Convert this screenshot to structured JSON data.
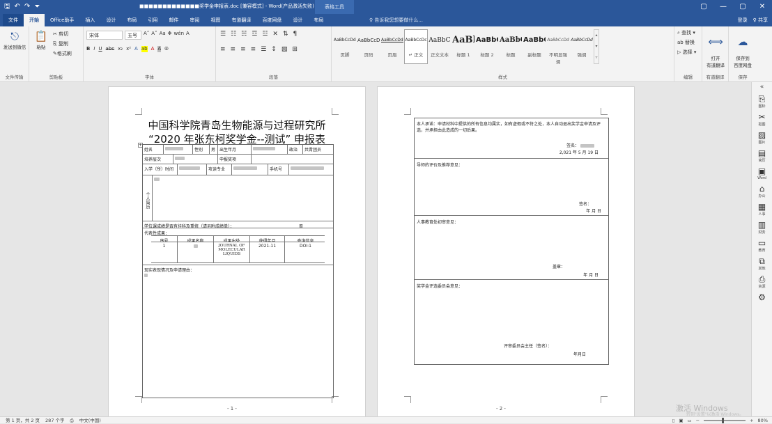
{
  "titlebar": {
    "doc_title": "■■■■■■■■■■■■■奖学金申报表.doc [兼容模式] - Word(产品激活失败)",
    "table_tools": "表格工具",
    "quick_access": [
      "🖫",
      "↶",
      "↷",
      "⏷"
    ],
    "controls": [
      "▢",
      "—",
      "▢",
      "✕"
    ]
  },
  "tabs": [
    "文件",
    "开始",
    "Office助手",
    "插入",
    "设计",
    "布局",
    "引用",
    "邮件",
    "审阅",
    "视图",
    "有道翻译",
    "百度网盘",
    "设计",
    "布局"
  ],
  "tell_me": "♀ 告诉我您想要做什么...",
  "account": {
    "login": "登录",
    "share": "♀ 共享"
  },
  "ribbon": {
    "groups": {
      "file_transfer": "文件传输",
      "clipboard": "剪贴板",
      "font": "字体",
      "paragraph": "段落",
      "styles": "样式",
      "editing": "编辑",
      "youdao": "有道翻译",
      "save": "保存"
    },
    "send_wechat": "发送到微信",
    "paste": "粘贴",
    "cut": "✂ 剪切",
    "copy": "⎘ 复制",
    "format_painter": "✎格式刷",
    "font_name": "宋体",
    "font_size": "五号",
    "font_row1": [
      "A˄",
      "A˅",
      "Aa",
      "✥",
      "wén",
      "A"
    ],
    "font_row2": [
      "B",
      "I",
      "U",
      "abc",
      "x₂",
      "x²",
      "A",
      "ab",
      "A",
      "A",
      "⦾"
    ],
    "para_row1": [
      "☰",
      "☷",
      "☵",
      "☲",
      "☳",
      "✕",
      "⇅",
      "¶"
    ],
    "para_row2": [
      "≡",
      "≡",
      "≡",
      "≡",
      "☰",
      "↕",
      "▧",
      "⊞"
    ],
    "styles": [
      {
        "sample": "AaBbCcDdE",
        "name": "页脚"
      },
      {
        "sample": "AaBbCcDd",
        "name": "页码"
      },
      {
        "sample": "AaBbCcDdE",
        "name": "页眉"
      },
      {
        "sample": "AaBbCcDc",
        "name": "↵ 正文"
      },
      {
        "sample": "AaBbC",
        "name": "正文文本"
      },
      {
        "sample": "AaBl",
        "name": "标题 1"
      },
      {
        "sample": "AaBbC",
        "name": "标题 2"
      },
      {
        "sample": "AaBbC",
        "name": "标题"
      },
      {
        "sample": "AaBbC",
        "name": "副标题"
      },
      {
        "sample": "AaBbCcDd",
        "name": "不明显强调"
      },
      {
        "sample": "AaBbCcDd",
        "name": "强调"
      }
    ],
    "find": "⌕ 查找 ▾",
    "replace": "ab 替换",
    "select": "▷ 选择 ▾",
    "open_youdao": "打开\n有道翻译",
    "save_baidu": "保存到\n百度网盘"
  },
  "page1": {
    "title1": "中国科学院青岛生物能源与过程研究所",
    "title2": "“2020 年张东柯奖学金--测试” 申报表",
    "row1": {
      "name_label": "姓名",
      "gender_label": "性别",
      "gender_value": "男",
      "birth_label": "出生年月",
      "politics_label": "政治面目",
      "politics_value": "共青团员"
    },
    "row2": {
      "edu_label": "培养层次",
      "award_label": "申报奖项"
    },
    "row3": {
      "entry_label": "入学（所）时间",
      "major_label": "攻读专业",
      "phone_label": "手机号"
    },
    "resume_label": "个人简历",
    "score_row": "学位课成绩是否有挂科及重修（请另附成绩单）：",
    "score_value": "否",
    "works_label": "代表性成果：",
    "works_headers": [
      "序号",
      "成果名称",
      "成果出处",
      "获得年月",
      "查询信息"
    ],
    "works_row": [
      "1",
      "",
      "JOURNAL OF MOLECULAR LIQUIDS",
      "2021-11",
      "DOI:1"
    ],
    "reason_label": "现实表现情况及申请理由：",
    "page_num": "- 1 -"
  },
  "page2": {
    "pledge": "本人承诺：申请材料中提供的所有信息均属实，如有虚假或不符之处，本人自动退出奖学金申请及评选，并承担由此造成的一切后果。",
    "sign_label": "签名：",
    "sign_date": "2,021 年 5 月 19 日",
    "advisor_label": "导师的评价及推荐意见：",
    "advisor_sign": "签名：",
    "advisor_date": "年 月 日",
    "dept_label": "人事教育处初审意见：",
    "dept_stamp": "盖章：",
    "dept_date": "年    月    日",
    "committee_label": "奖学金评选委员会意见：",
    "chair_sign": "评审委员会主任（签名）：",
    "chair_date": "年月日",
    "page_num": "- 2 -"
  },
  "right_panel": [
    {
      "icon": "⎘",
      "label": "图标"
    },
    {
      "icon": "✂",
      "label": "抠图"
    },
    {
      "icon": "▨",
      "label": "图片"
    },
    {
      "icon": "▤",
      "label": "简历"
    },
    {
      "icon": "▣",
      "label": "Word"
    },
    {
      "icon": "⌂",
      "label": "办公"
    },
    {
      "icon": "▦",
      "label": "人事"
    },
    {
      "icon": "▥",
      "label": "财务"
    },
    {
      "icon": "▭",
      "label": "教育"
    },
    {
      "icon": "⧉",
      "label": "其他"
    },
    {
      "icon": "⎙",
      "label": "资源"
    },
    {
      "icon": "⚙",
      "label": ""
    }
  ],
  "statusbar": {
    "page": "第 1 页，共 2 页",
    "words": "287 个字",
    "lang": "中文(中国)",
    "zoom": "80%"
  },
  "watermark": {
    "line1": "激活 Windows",
    "line2": "转到\"设置\"以激活 Windows。"
  }
}
